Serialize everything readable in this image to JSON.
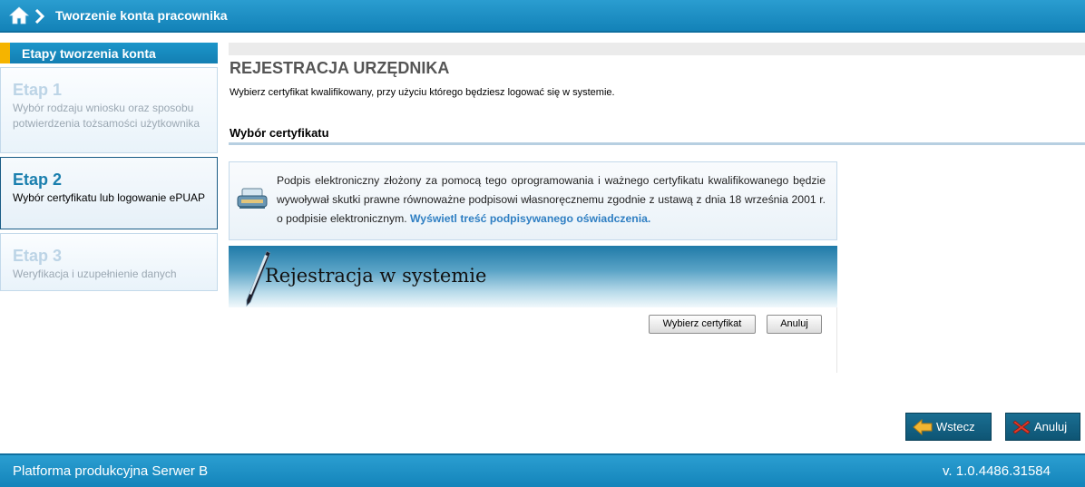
{
  "header": {
    "breadcrumb": "Tworzenie konta pracownika"
  },
  "sidebar": {
    "title": "Etapy tworzenia konta",
    "steps": [
      {
        "label": "Etap 1",
        "description": "Wybór rodzaju wniosku oraz sposobu potwierdzenia tożsamości użytkownika",
        "state": "inactive"
      },
      {
        "label": "Etap 2",
        "description": "Wybór certyfikatu lub logowanie ePUAP",
        "state": "active"
      },
      {
        "label": "Etap 3",
        "description": "Weryfikacja i uzupełnienie danych",
        "state": "inactive"
      }
    ]
  },
  "main": {
    "title": "REJESTRACJA URZĘDNIKA",
    "intro": "Wybierz certyfikat kwalifikowany, przy użyciu którego będziesz logować się w systemie.",
    "section_title": "Wybór certyfikatu",
    "info_text": "Podpis elektroniczny złożony za pomocą tego oprogramowania i ważnego certyfikatu kwalifikowanego będzie wywoływał skutki prawne równoważne podpisowi własnoręcznemu zgodnie z ustawą z dnia 18 września 2001 r. o podpisie elektronicznym.",
    "info_link": "Wyświetl treść podpisywanego oświadczenia.",
    "registration": {
      "title": "Rejestracja w systemie",
      "select_button": "Wybierz certyfikat",
      "cancel_button": "Anuluj"
    }
  },
  "actions": {
    "back": "Wstecz",
    "cancel": "Anuluj"
  },
  "footer": {
    "platform": "Platforma produkcyjna Serwer B",
    "version": "v. 1.0.4486.31584"
  },
  "icons": {
    "home": "home-icon",
    "breadcrumb_separator": "chevron-right-icon",
    "info": "printer-icon",
    "banner": "pen-icon",
    "back": "arrow-left-icon",
    "cancel": "close-icon"
  },
  "colors": {
    "header_blue": "#1a8ec4",
    "sidebar_accent": "#f5b400",
    "active_step_title": "#1a7fae",
    "link": "#2f7fc3",
    "action_button": "#136383"
  }
}
